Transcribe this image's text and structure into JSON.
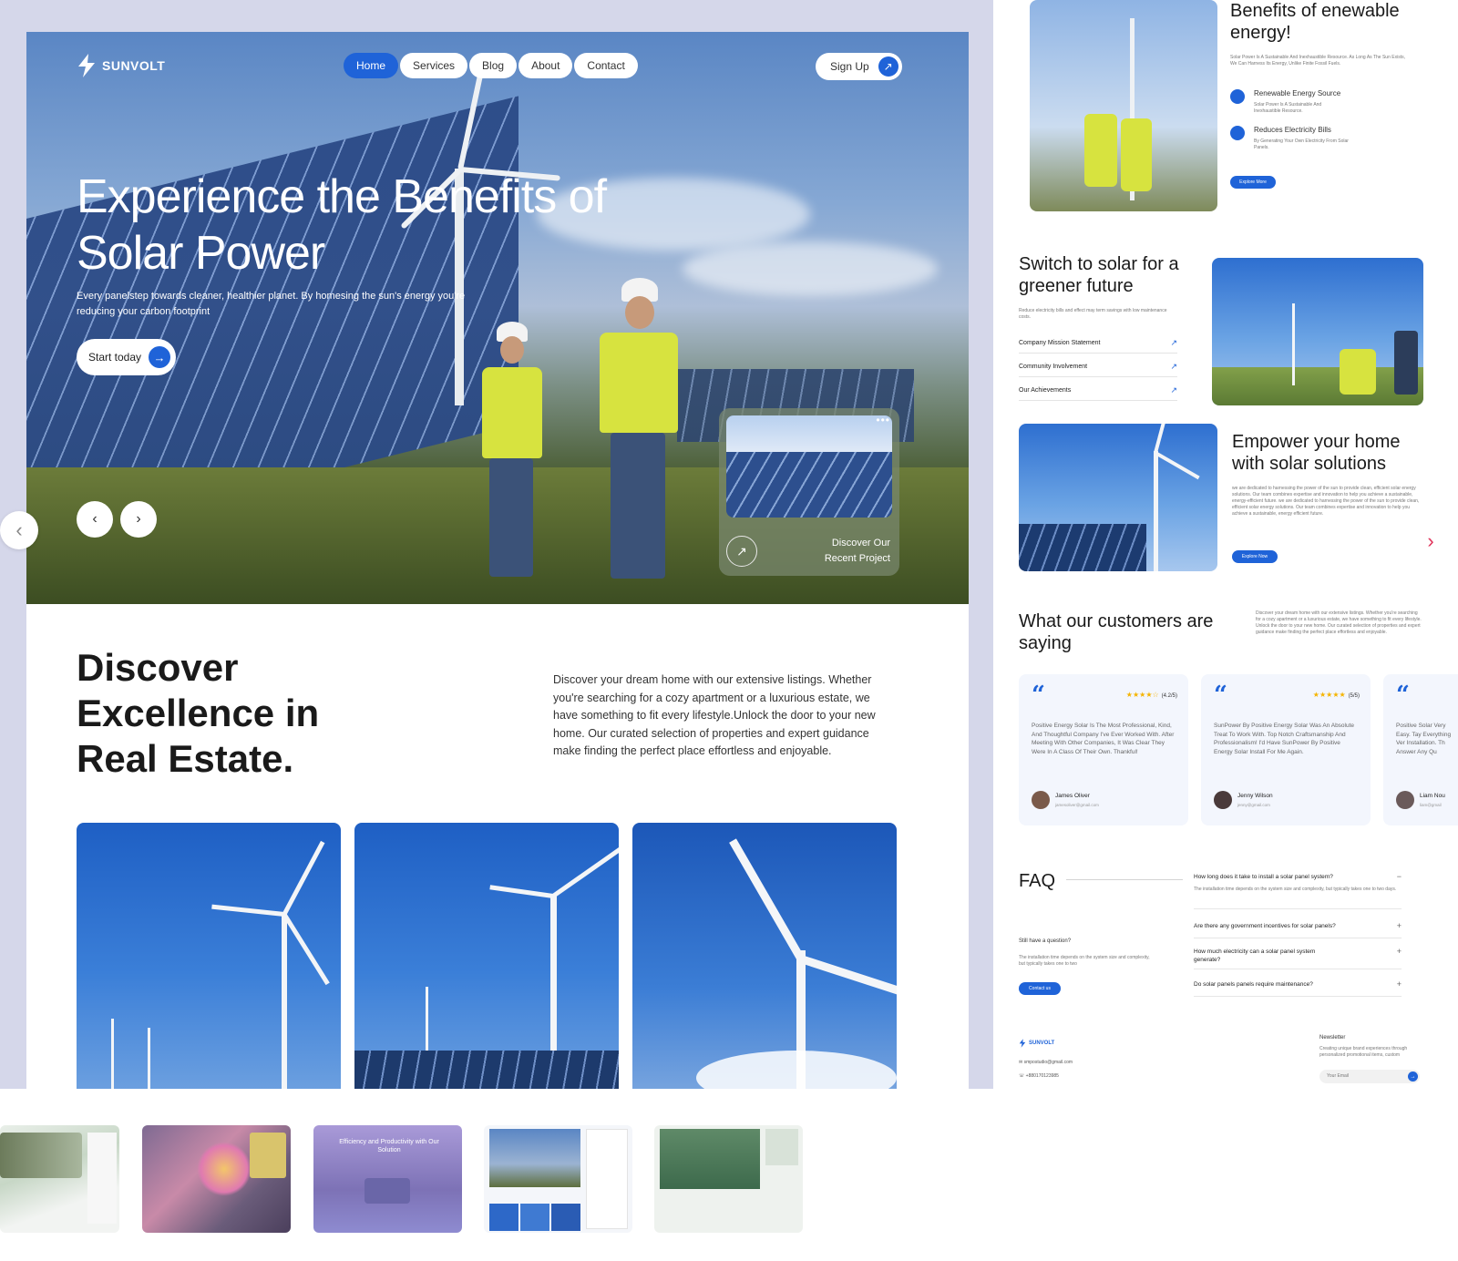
{
  "brand": {
    "name": "SUNVOLT"
  },
  "nav": {
    "links": [
      "Home",
      "Services",
      "Blog",
      "About",
      "Contact"
    ],
    "signup_label": "Sign Up"
  },
  "hero": {
    "title": "Experience the Benefits of Solar Power",
    "subtitle": "Every panelstep towards cleaner, healthier planet. By homesing the sun's energy you're reducing your carbon footprint",
    "cta_label": "Start today",
    "project_card_text": "Discover Our Recent Project"
  },
  "discover": {
    "title": "Discover Excellence in Real Estate.",
    "description": "Discover your dream home with our extensive listings. Whether you're searching for a cozy apartment or a luxurious estate, we have something to fit every lifestyle.Unlock the door to your new home. Our curated selection of properties and expert guidance make finding the perfect place effortless and enjoyable."
  },
  "right_page": {
    "benefits": {
      "title": "Benefits of enewable energy!",
      "intro": "Solar Power Is A Sustainable And Inexhaustible Resource. As Long As The Sun Exists, We Can Harness Its Energy, Unlike Finite Fossil Fuels.",
      "items": [
        {
          "title": "Renewable Energy Source",
          "text": "Solar Power Is A Sustainable And Inexhaustible Resource."
        },
        {
          "title": "Reduces Electricity Bills",
          "text": "By Generating Your Own Electricity From Solar Panels."
        }
      ],
      "button_label": "Explore More"
    },
    "switch": {
      "title": "Switch to solar for a greener future",
      "text": "Reduce electricity bills and effect may term savings with low maintenance costs.",
      "rows": [
        "Company Mission Statement",
        "Community Involvement",
        "Our Achievements"
      ]
    },
    "empower": {
      "title": "Empower your home with solar solutions",
      "text": "we are dedicated to harnessing the power of the sun to provide clean, efficient solar energy solutions. Our team combines expertise and innovation to help you achieve a sustainable, energy-efficient future. we are dedicated to harnessing the power of the sun to provide clean, efficient solar energy solutions. Our team combines expertise and innovation to help you achieve a sustainable, energy efficient future.",
      "button_label": "Explore Now"
    },
    "testimonials": {
      "title": "What our customers are saying",
      "intro": "Discover your dream home with our extensive listings. Whether you're searching for a cozy apartment or a luxurious estate, we have something to fit every lifestyle. Unlock the door to your new home. Our curated selection of properties and expert guidance make finding the perfect place effortless and enjoyable.",
      "cards": [
        {
          "rating": "(4.2/5)",
          "body": "Positive Energy Solar Is The Most Professional, Kind, And Thoughtful Company I've Ever Worked With. After Meeting With Other Companies, It Was Clear They Were In A Class Of Their Own. Thankful!",
          "name": "James Oliver",
          "email": "jamesoliver@gmail.com"
        },
        {
          "rating": "(5/5)",
          "body": "SunPower By Positive Energy Solar Was An Absolute Treat To Work With. Top Notch Craftsmanship And Professionalism! I'd Have SunPower By Positive Energy Solar Install For Me Again.",
          "name": "Jenny Wilson",
          "email": "jenny@gmail.com"
        },
        {
          "rating": "",
          "body": "Positive Solar Very Easy. Tay Everything Ver Installation. Th Answer Any Qu",
          "name": "Liam Nou",
          "email": "liam@gmail"
        }
      ]
    },
    "faq": {
      "title": "FAQ",
      "still_question": "Still have a question?",
      "still_text": "The installation time depends on the system size and complexity, but typically takes one to two",
      "contact_label": "Contact us",
      "items": [
        {
          "q": "How long does it take to install a solar panel system?",
          "a": "The installation time depends on the system size and complexity, but typically takes one to two days."
        },
        {
          "q": "Are there any government incentives for solar panels?",
          "a": ""
        },
        {
          "q": "How much electricity can a solar panel system generate?",
          "a": ""
        },
        {
          "q": "Do solar panels panels require maintenance?",
          "a": ""
        }
      ]
    },
    "footer": {
      "brand": "SUNVOLT",
      "email": "smpostudio@gmail.com",
      "phone": "+880170123985",
      "newsletter_title": "Newsletter",
      "newsletter_text": "Creating unique brand experiences through personalized promotional items, custom",
      "email_placeholder": "Your Email"
    }
  },
  "thumbnails": [
    {
      "caption": ""
    },
    {
      "caption": ""
    },
    {
      "caption": "Efficiency and Productivity with Our Solution"
    },
    {
      "caption": ""
    },
    {
      "caption": ""
    }
  ],
  "colors": {
    "accent": "#1f63d8",
    "backdrop": "#d5d7ea",
    "vest": "#d7e33f"
  }
}
